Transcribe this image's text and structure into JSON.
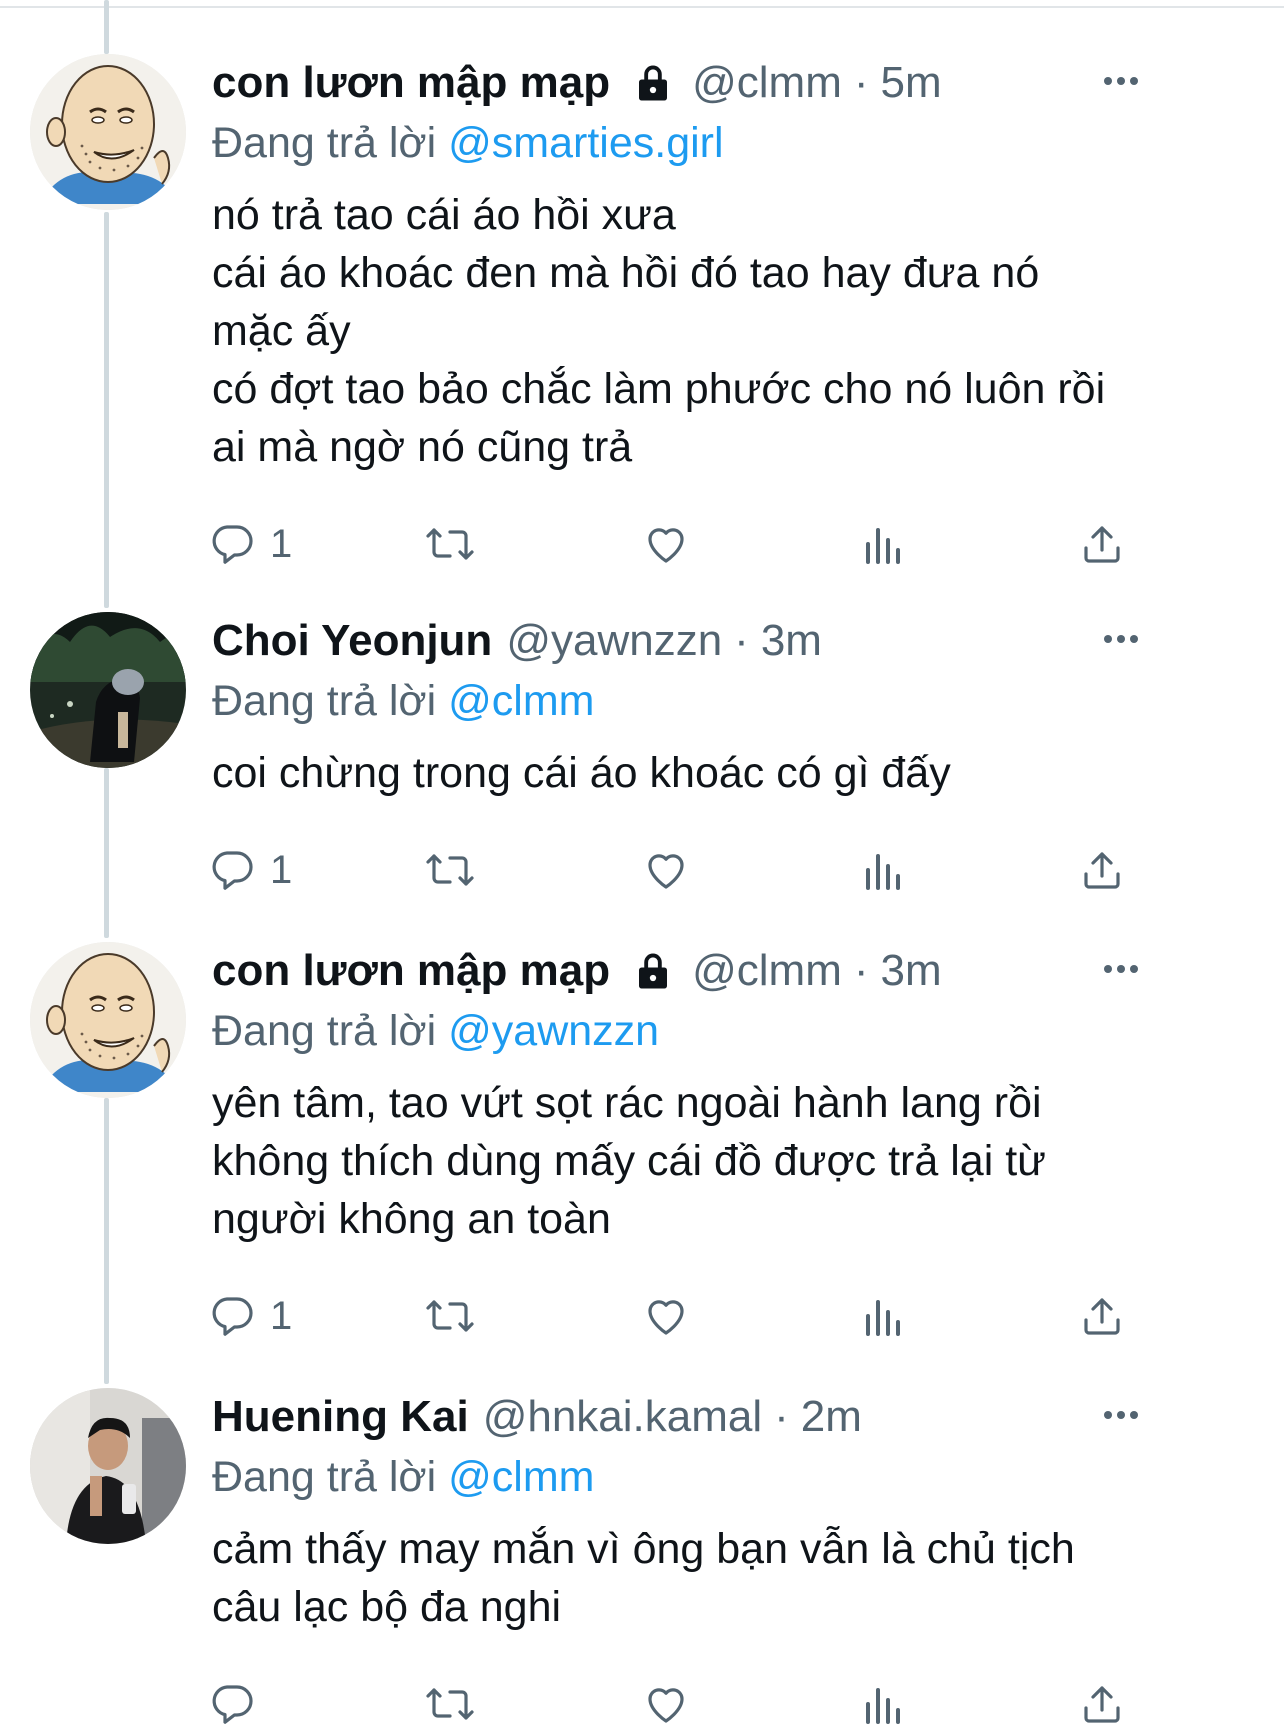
{
  "thread": {
    "tweets": [
      {
        "display_name": "con lươn mập mạp",
        "protected": true,
        "handle": "@clmm",
        "time": "5m",
        "reply_prefix": "Đang trả lời ",
        "reply_to": "@smarties.girl",
        "text_lines": [
          "nó trả tao cái áo hồi xưa",
          "cái áo khoác đen mà hồi đó tao hay đưa nó",
          "mặc ấy",
          "có đợt tao bảo chắc làm phước cho nó luôn rồi",
          "ai mà ngờ nó cũng trả"
        ],
        "reply_count": "1",
        "avatar": "cartoon-bald-man"
      },
      {
        "display_name": "Choi Yeonjun",
        "protected": false,
        "handle": "@yawnzzn",
        "time": "3m",
        "reply_prefix": "Đang trả lời ",
        "reply_to": "@clmm",
        "text_lines": [
          "coi chừng trong cái áo khoác có gì đấy"
        ],
        "reply_count": "1",
        "avatar": "night-photo-person"
      },
      {
        "display_name": "con lươn mập mạp",
        "protected": true,
        "handle": "@clmm",
        "time": "3m",
        "reply_prefix": "Đang trả lời ",
        "reply_to": "@yawnzzn",
        "text_lines": [
          "yên tâm, tao vứt sọt rác ngoài hành lang rồi",
          "không thích dùng mấy cái đồ được trả lại từ",
          "người không an toàn"
        ],
        "reply_count": "1",
        "avatar": "cartoon-bald-man"
      },
      {
        "display_name": "Huening Kai",
        "protected": false,
        "handle": "@hnkai.kamal",
        "time": "2m",
        "reply_prefix": "Đang trả lời ",
        "reply_to": "@clmm",
        "text_lines": [
          "cảm thấy may mắn vì ông bạn vẫn là chủ tịch",
          "câu lạc bộ đa nghi"
        ],
        "reply_count": "",
        "avatar": "mirror-selfie-person"
      }
    ],
    "separator": "·",
    "icons": {
      "lock": "lock-icon",
      "more": "more-icon",
      "reply": "reply-icon",
      "retweet": "retweet-icon",
      "like": "heart-icon",
      "views": "views-icon",
      "share": "share-icon"
    },
    "colors": {
      "text": "#0f1419",
      "secondary": "#536471",
      "link": "#1d9bf0",
      "thread_line": "#cfd9de"
    }
  }
}
